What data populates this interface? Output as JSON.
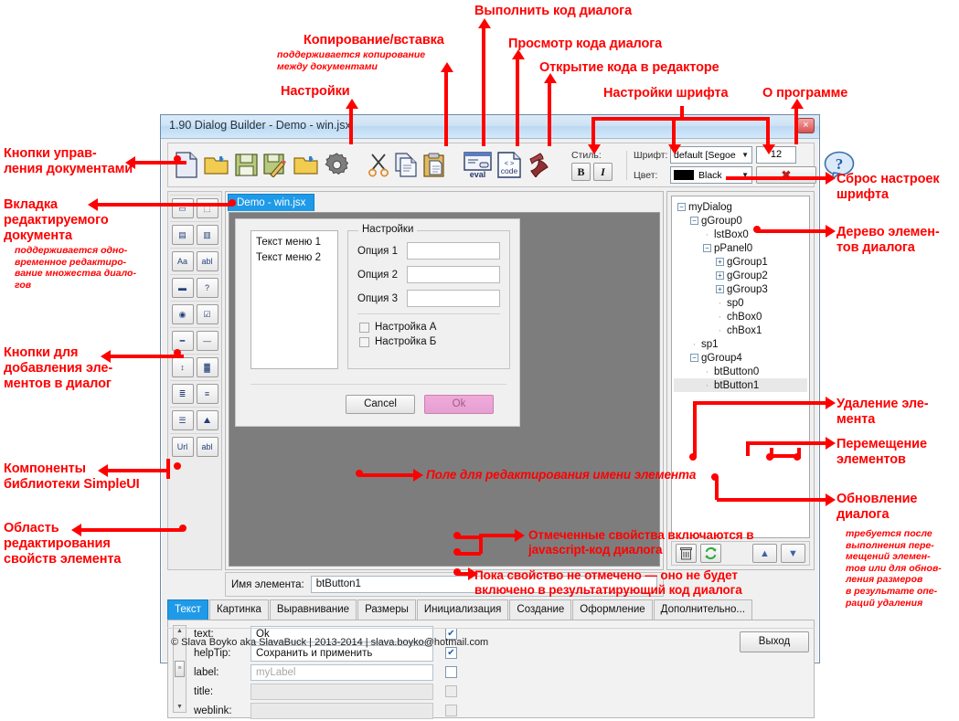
{
  "window": {
    "title": "1.90 Dialog Builder - Demo - win.jsx",
    "close_label": "×"
  },
  "toolbar": {
    "icons": [
      {
        "name": "new-document-icon",
        "label": "new"
      },
      {
        "name": "open-document-icon",
        "label": "open"
      },
      {
        "name": "save-document-icon",
        "label": "save"
      },
      {
        "name": "save-as-document-icon",
        "label": "save-as"
      },
      {
        "name": "import-document-icon",
        "label": "import"
      },
      {
        "name": "settings-gear-icon",
        "label": "settings"
      },
      {
        "name": "cut-icon",
        "label": "cut"
      },
      {
        "name": "copy-icon",
        "label": "copy"
      },
      {
        "name": "paste-icon",
        "label": "paste"
      },
      {
        "name": "eval-dialog-icon",
        "label": "eval"
      },
      {
        "name": "view-code-icon",
        "label": "code"
      },
      {
        "name": "open-in-editor-icon",
        "label": "editor"
      }
    ],
    "style_label": "Стиль:",
    "bold_label": "B",
    "italic_label": "I",
    "font_label": "Шрифт:",
    "font_value": "default [Segoe",
    "font_size": "12",
    "color_label": "Цвет:",
    "color_value": "Black",
    "color_hex": "#000000",
    "reset_label": "✖",
    "help_label": "?"
  },
  "palette": {
    "groups": [
      {
        "buttons": [
          {
            "name": "palette-panel-button",
            "glyph": "▭"
          },
          {
            "name": "palette-dashed-panel-button",
            "glyph": "⬚"
          }
        ]
      },
      {
        "buttons": [
          {
            "name": "palette-group-left-button",
            "glyph": "▤"
          },
          {
            "name": "palette-group-right-button",
            "glyph": "▥"
          }
        ]
      },
      {
        "buttons": [
          {
            "name": "palette-static-text-button",
            "glyph": "Aa"
          },
          {
            "name": "palette-edit-text-button",
            "glyph": "abl"
          }
        ]
      },
      {
        "buttons": [
          {
            "name": "palette-button-button",
            "glyph": "▬"
          },
          {
            "name": "palette-icon-button-button",
            "glyph": "?"
          }
        ]
      },
      {
        "buttons": [
          {
            "name": "palette-radio-button",
            "glyph": "◉"
          },
          {
            "name": "palette-checkbox-button",
            "glyph": "☑"
          }
        ]
      },
      {
        "buttons": [
          {
            "name": "palette-slider-button",
            "glyph": "━"
          },
          {
            "name": "palette-separator-button",
            "glyph": "—"
          }
        ]
      },
      {
        "buttons": [
          {
            "name": "palette-spinner-button",
            "glyph": "↕"
          },
          {
            "name": "palette-progressbar-button",
            "glyph": "▓"
          }
        ]
      },
      {
        "buttons": [
          {
            "name": "palette-listbox-button",
            "glyph": "≣"
          },
          {
            "name": "palette-dropdownlist-button",
            "glyph": "≡"
          }
        ]
      },
      {
        "buttons": [
          {
            "name": "palette-treeview-button",
            "glyph": "☰"
          },
          {
            "name": "palette-image-button",
            "glyph": "⛰"
          }
        ]
      },
      {
        "buttons": [
          {
            "name": "palette-url-button",
            "glyph": "Url"
          },
          {
            "name": "palette-simpleui-text-button",
            "glyph": "abl"
          }
        ]
      }
    ]
  },
  "canvas": {
    "tab_label": "Demo - win.jsx",
    "preview": {
      "listbox_items": [
        "Текст меню 1",
        "Текст меню 2"
      ],
      "group_legend": "Настройки",
      "options": [
        {
          "label": "Опция 1",
          "value": ""
        },
        {
          "label": "Опция 2",
          "value": ""
        },
        {
          "label": "Опция 3",
          "value": ""
        }
      ],
      "checkboxes": [
        {
          "label": "Настройка А",
          "checked": false
        },
        {
          "label": "Настройка Б",
          "checked": false
        }
      ],
      "cancel_label": "Cancel",
      "ok_label": "Ok"
    }
  },
  "tree": {
    "nodes": [
      {
        "label": "myDialog",
        "depth": 0,
        "expander": "−",
        "selected": false
      },
      {
        "label": "gGroup0",
        "depth": 1,
        "expander": "−",
        "selected": false
      },
      {
        "label": "lstBox0",
        "depth": 2,
        "expander": "",
        "selected": false
      },
      {
        "label": "pPanel0",
        "depth": 2,
        "expander": "−",
        "selected": false
      },
      {
        "label": "gGroup1",
        "depth": 3,
        "expander": "+",
        "selected": false
      },
      {
        "label": "gGroup2",
        "depth": 3,
        "expander": "+",
        "selected": false
      },
      {
        "label": "gGroup3",
        "depth": 3,
        "expander": "+",
        "selected": false
      },
      {
        "label": "sp0",
        "depth": 3,
        "expander": "",
        "selected": false
      },
      {
        "label": "chBox0",
        "depth": 3,
        "expander": "",
        "selected": false
      },
      {
        "label": "chBox1",
        "depth": 3,
        "expander": "",
        "selected": false
      },
      {
        "label": "sp1",
        "depth": 1,
        "expander": "",
        "selected": false
      },
      {
        "label": "gGroup4",
        "depth": 1,
        "expander": "−",
        "selected": false
      },
      {
        "label": "btButton0",
        "depth": 2,
        "expander": "",
        "selected": false
      },
      {
        "label": "btButton1",
        "depth": 2,
        "expander": "",
        "selected": true
      }
    ],
    "buttons": [
      {
        "name": "delete-element-button",
        "glyph": "🗑"
      },
      {
        "name": "refresh-dialog-button",
        "glyph": "↻"
      },
      {
        "name": "move-element-up-button",
        "glyph": "▲"
      },
      {
        "name": "move-element-down-button",
        "glyph": "▼"
      }
    ]
  },
  "name_row": {
    "label": "Имя элемента:",
    "value": "btButton1"
  },
  "prop_tabs": [
    {
      "label": "Текст",
      "active": true
    },
    {
      "label": "Картинка",
      "active": false
    },
    {
      "label": "Выравнивание",
      "active": false
    },
    {
      "label": "Размеры",
      "active": false
    },
    {
      "label": "Инициализация",
      "active": false
    },
    {
      "label": "Создание",
      "active": false
    },
    {
      "label": "Оформление",
      "active": false
    },
    {
      "label": "Дополнительно...",
      "active": false
    }
  ],
  "properties": [
    {
      "name": "text:",
      "value": "Ok",
      "placeholder": "",
      "checked": true,
      "disabled": false
    },
    {
      "name": "helpTip:",
      "value": "Сохранить и применить",
      "placeholder": "",
      "checked": true,
      "disabled": false
    },
    {
      "name": "label:",
      "value": "",
      "placeholder": "myLabel",
      "checked": false,
      "disabled": false
    },
    {
      "name": "title:",
      "value": "",
      "placeholder": "",
      "checked": false,
      "disabled": true
    },
    {
      "name": "weblink:",
      "value": "",
      "placeholder": "",
      "checked": false,
      "disabled": true
    }
  ],
  "footer": {
    "copyright": "© Slava Boyko aka SlavaBuck | 2013-2014 | slava.boyko@hotmail.com",
    "exit_label": "Выход"
  },
  "annotations": {
    "doc_buttons": "Кнопки управ-\nления документами",
    "doc_tab": "Вкладка\nредактируемого\nдокумента",
    "doc_tab_sub": "поддерживается одно-\nвременное редактиро-\nвание множества диало-\nгов",
    "add_elements": "Кнопки для\nдобавления эле-\nментов в диалог",
    "simpleui": "Компоненты\nбиблиотеки SimpleUI",
    "props_area": "Область\nредактирования\nсвойств элемента",
    "settings": "Настройки",
    "copypaste": "Копирование/вставка",
    "copypaste_sub": "поддерживается копирование\nмежду документами",
    "run_code": "Выполнить код диалога",
    "view_code": "Просмотр кода диалога",
    "open_editor": "Открытие кода в редакторе",
    "font_settings": "Настройки шрифта",
    "about": "О программе",
    "font_reset": "Сброс настроек\nшрифта",
    "tree_elements": "Дерево элемен-\nтов диалога",
    "delete_element": "Удаление эле-\nмента",
    "move_elements": "Перемещение\nэлементов",
    "refresh_dialog": "Обновление\nдиалога",
    "refresh_dialog_sub": "требуется после\nвыполнения пере-\nмещений элемен-\nтов или для обнов-\nления размеров\nв результате опе-\nраций удаления",
    "name_field": "Поле для редактирования имени элемента",
    "checked_props": "Отмеченные свойства включаются в\njavascript-код диалога",
    "unchecked_props": "Пока свойство не отмечено — оно не будет\nвключено в результатирующий код диалога"
  }
}
